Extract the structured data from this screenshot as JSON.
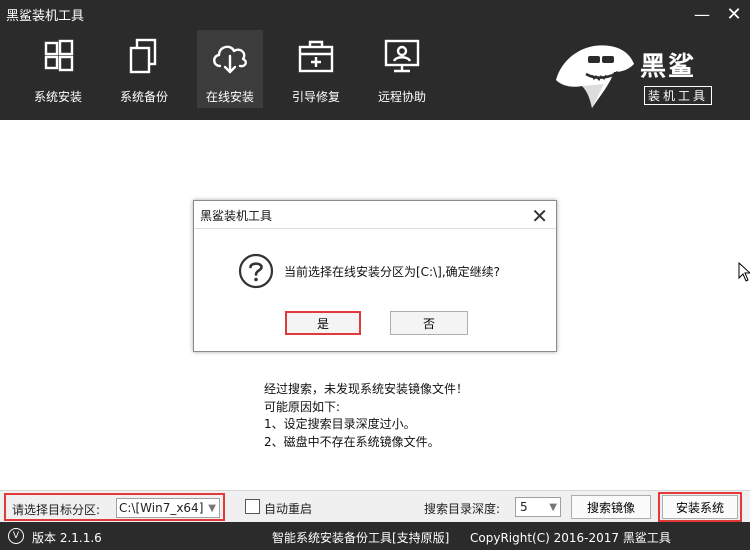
{
  "window": {
    "title": "黑鲨装机工具",
    "minimize_glyph": "—",
    "close_glyph": "✕"
  },
  "nav": {
    "items": [
      {
        "label": "系统安装",
        "icon": "windows-icon",
        "active": false
      },
      {
        "label": "系统备份",
        "icon": "copy-icon",
        "active": false
      },
      {
        "label": "在线安装",
        "icon": "cloud-download-icon",
        "active": true
      },
      {
        "label": "引导修复",
        "icon": "toolbox-icon",
        "active": false
      },
      {
        "label": "远程协助",
        "icon": "remote-monitor-icon",
        "active": false
      }
    ]
  },
  "logo": {
    "brand_name": "黑鲨",
    "brand_subtitle": "装机工具"
  },
  "dialog": {
    "title": "黑鲨装机工具",
    "message": "当前选择在线安装分区为[C:\\],确定继续?",
    "yes_label": "是",
    "no_label": "否",
    "icon": "question-icon"
  },
  "info": {
    "lines": [
      "经过搜索，未发现系统安装镜像文件！",
      "可能原因如下:",
      "1、设定搜索目录深度过小。",
      "2、磁盘中不存在系统镜像文件。"
    ]
  },
  "toolbar": {
    "target_label": "请选择目标分区:",
    "target_value": "C:\\[Win7_x64]",
    "autoreboot_label": "自动重启",
    "autoreboot_checked": false,
    "depth_label": "搜索目录深度:",
    "depth_value": "5",
    "search_image_label": "搜索镜像",
    "install_label": "安装系统"
  },
  "status": {
    "version_text": "版本 2.1.1.6",
    "product_text": "智能系统安装备份工具[支持原版]",
    "copyright_text": "CopyRight(C) 2016-2017 黑鲨工具"
  },
  "colors": {
    "header_bg": "#2b2b2b",
    "highlight_red": "#e23a3a",
    "active_nav_bg": "#3c3c3c"
  }
}
